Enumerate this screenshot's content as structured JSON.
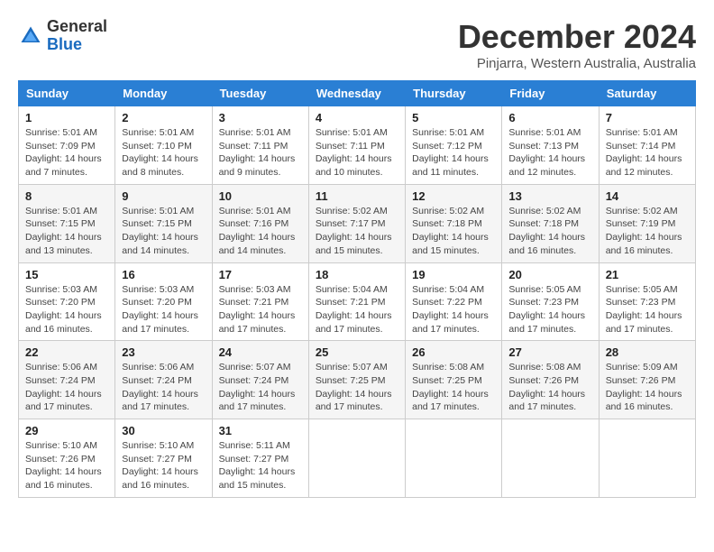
{
  "logo": {
    "general": "General",
    "blue": "Blue"
  },
  "title": "December 2024",
  "subtitle": "Pinjarra, Western Australia, Australia",
  "days_header": [
    "Sunday",
    "Monday",
    "Tuesday",
    "Wednesday",
    "Thursday",
    "Friday",
    "Saturday"
  ],
  "weeks": [
    [
      {
        "day": "1",
        "info": "Sunrise: 5:01 AM\nSunset: 7:09 PM\nDaylight: 14 hours\nand 7 minutes."
      },
      {
        "day": "2",
        "info": "Sunrise: 5:01 AM\nSunset: 7:10 PM\nDaylight: 14 hours\nand 8 minutes."
      },
      {
        "day": "3",
        "info": "Sunrise: 5:01 AM\nSunset: 7:11 PM\nDaylight: 14 hours\nand 9 minutes."
      },
      {
        "day": "4",
        "info": "Sunrise: 5:01 AM\nSunset: 7:11 PM\nDaylight: 14 hours\nand 10 minutes."
      },
      {
        "day": "5",
        "info": "Sunrise: 5:01 AM\nSunset: 7:12 PM\nDaylight: 14 hours\nand 11 minutes."
      },
      {
        "day": "6",
        "info": "Sunrise: 5:01 AM\nSunset: 7:13 PM\nDaylight: 14 hours\nand 12 minutes."
      },
      {
        "day": "7",
        "info": "Sunrise: 5:01 AM\nSunset: 7:14 PM\nDaylight: 14 hours\nand 12 minutes."
      }
    ],
    [
      {
        "day": "8",
        "info": "Sunrise: 5:01 AM\nSunset: 7:15 PM\nDaylight: 14 hours\nand 13 minutes."
      },
      {
        "day": "9",
        "info": "Sunrise: 5:01 AM\nSunset: 7:15 PM\nDaylight: 14 hours\nand 14 minutes."
      },
      {
        "day": "10",
        "info": "Sunrise: 5:01 AM\nSunset: 7:16 PM\nDaylight: 14 hours\nand 14 minutes."
      },
      {
        "day": "11",
        "info": "Sunrise: 5:02 AM\nSunset: 7:17 PM\nDaylight: 14 hours\nand 15 minutes."
      },
      {
        "day": "12",
        "info": "Sunrise: 5:02 AM\nSunset: 7:18 PM\nDaylight: 14 hours\nand 15 minutes."
      },
      {
        "day": "13",
        "info": "Sunrise: 5:02 AM\nSunset: 7:18 PM\nDaylight: 14 hours\nand 16 minutes."
      },
      {
        "day": "14",
        "info": "Sunrise: 5:02 AM\nSunset: 7:19 PM\nDaylight: 14 hours\nand 16 minutes."
      }
    ],
    [
      {
        "day": "15",
        "info": "Sunrise: 5:03 AM\nSunset: 7:20 PM\nDaylight: 14 hours\nand 16 minutes."
      },
      {
        "day": "16",
        "info": "Sunrise: 5:03 AM\nSunset: 7:20 PM\nDaylight: 14 hours\nand 17 minutes."
      },
      {
        "day": "17",
        "info": "Sunrise: 5:03 AM\nSunset: 7:21 PM\nDaylight: 14 hours\nand 17 minutes."
      },
      {
        "day": "18",
        "info": "Sunrise: 5:04 AM\nSunset: 7:21 PM\nDaylight: 14 hours\nand 17 minutes."
      },
      {
        "day": "19",
        "info": "Sunrise: 5:04 AM\nSunset: 7:22 PM\nDaylight: 14 hours\nand 17 minutes."
      },
      {
        "day": "20",
        "info": "Sunrise: 5:05 AM\nSunset: 7:23 PM\nDaylight: 14 hours\nand 17 minutes."
      },
      {
        "day": "21",
        "info": "Sunrise: 5:05 AM\nSunset: 7:23 PM\nDaylight: 14 hours\nand 17 minutes."
      }
    ],
    [
      {
        "day": "22",
        "info": "Sunrise: 5:06 AM\nSunset: 7:24 PM\nDaylight: 14 hours\nand 17 minutes."
      },
      {
        "day": "23",
        "info": "Sunrise: 5:06 AM\nSunset: 7:24 PM\nDaylight: 14 hours\nand 17 minutes."
      },
      {
        "day": "24",
        "info": "Sunrise: 5:07 AM\nSunset: 7:24 PM\nDaylight: 14 hours\nand 17 minutes."
      },
      {
        "day": "25",
        "info": "Sunrise: 5:07 AM\nSunset: 7:25 PM\nDaylight: 14 hours\nand 17 minutes."
      },
      {
        "day": "26",
        "info": "Sunrise: 5:08 AM\nSunset: 7:25 PM\nDaylight: 14 hours\nand 17 minutes."
      },
      {
        "day": "27",
        "info": "Sunrise: 5:08 AM\nSunset: 7:26 PM\nDaylight: 14 hours\nand 17 minutes."
      },
      {
        "day": "28",
        "info": "Sunrise: 5:09 AM\nSunset: 7:26 PM\nDaylight: 14 hours\nand 16 minutes."
      }
    ],
    [
      {
        "day": "29",
        "info": "Sunrise: 5:10 AM\nSunset: 7:26 PM\nDaylight: 14 hours\nand 16 minutes."
      },
      {
        "day": "30",
        "info": "Sunrise: 5:10 AM\nSunset: 7:27 PM\nDaylight: 14 hours\nand 16 minutes."
      },
      {
        "day": "31",
        "info": "Sunrise: 5:11 AM\nSunset: 7:27 PM\nDaylight: 14 hours\nand 15 minutes."
      },
      null,
      null,
      null,
      null
    ]
  ]
}
